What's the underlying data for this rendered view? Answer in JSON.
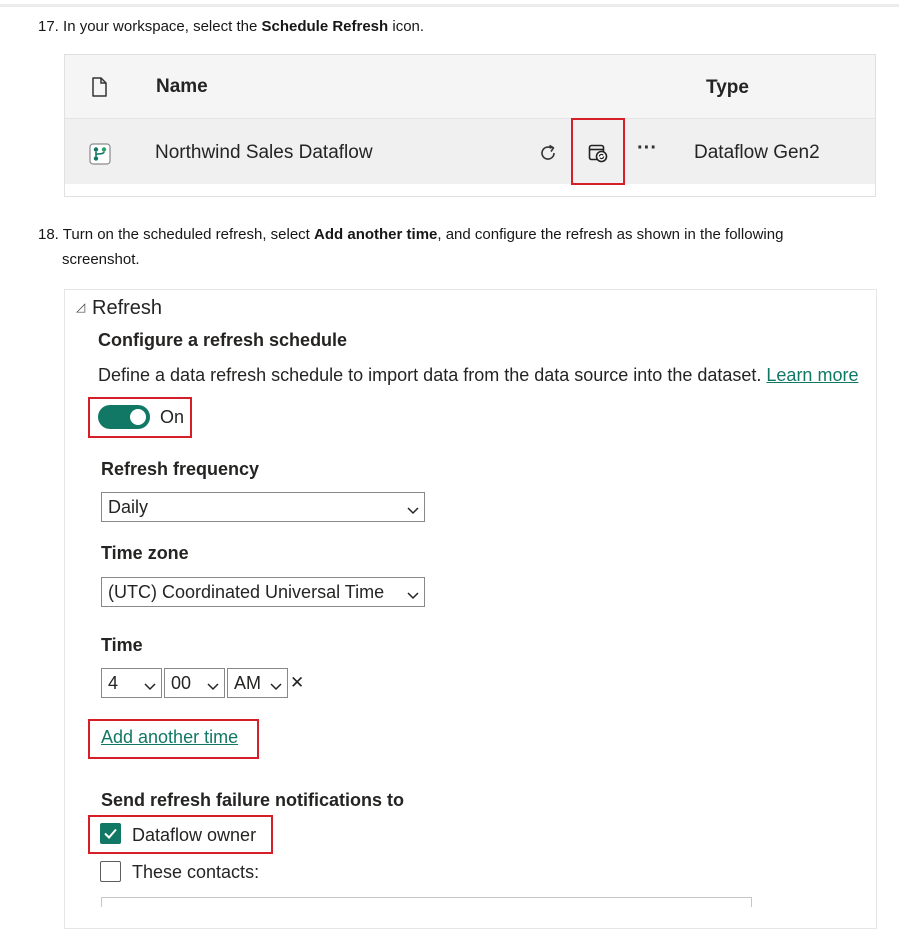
{
  "step17": {
    "number": "17.",
    "text_before": "In your workspace, select the",
    "bold": "Schedule Refresh",
    "text_after": "icon."
  },
  "workspace_table": {
    "col_name": "Name",
    "col_type": "Type",
    "row": {
      "name": "Northwind Sales Dataflow",
      "type": "Dataflow Gen2",
      "more": "···"
    },
    "icons": [
      "file-icon",
      "dataflow-icon",
      "refresh-icon",
      "schedule-refresh-icon"
    ]
  },
  "step18": {
    "number": "18.",
    "text_before": "Turn on the scheduled refresh, select",
    "bold": "Add another time",
    "text_after": ", and configure the refresh as shown in the following",
    "line2": "screenshot."
  },
  "refresh_panel": {
    "section_title": "Refresh",
    "configure_heading": "Configure a refresh schedule",
    "description": "Define a data refresh schedule to import data from the data source into the dataset.",
    "learn_more": "Learn more",
    "toggle_label": "On",
    "frequency_label": "Refresh frequency",
    "frequency_value": "Daily",
    "timezone_label": "Time zone",
    "timezone_value": "(UTC) Coordinated Universal Time",
    "time_label": "Time",
    "time_hour": "4",
    "time_minute": "00",
    "time_ampm": "AM",
    "remove_time": "✕",
    "add_another_time": "Add another time",
    "notifications_label": "Send refresh failure notifications to",
    "owner_checkbox_label": "Dataflow owner",
    "contacts_checkbox_label": "These contacts:"
  },
  "colors": {
    "accent": "#117865",
    "highlight": "#d71f2a"
  }
}
